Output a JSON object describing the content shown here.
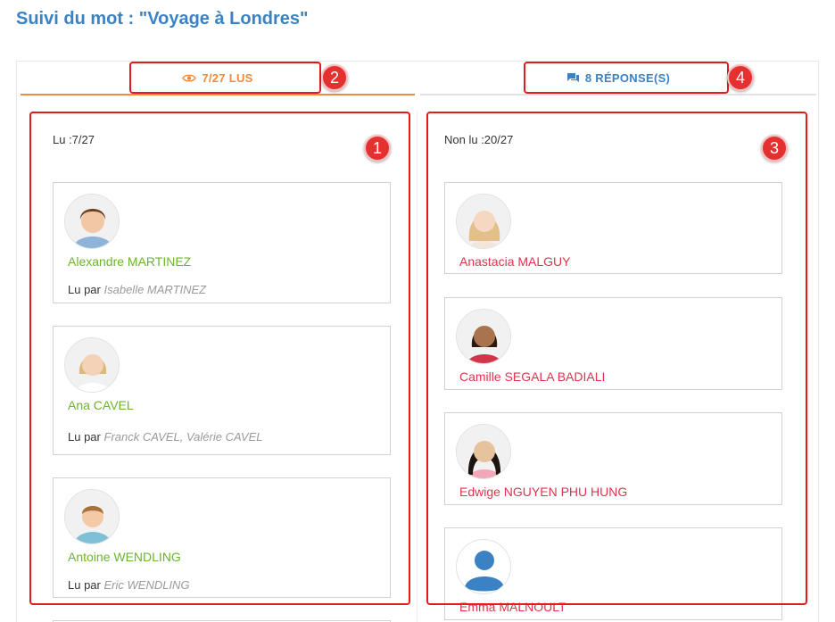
{
  "page": {
    "title": "Suivi du mot : \"Voyage à Londres\""
  },
  "tabs": {
    "read": {
      "label": "7/27 LUS",
      "icon": "eye-icon",
      "color": "#f08a3c"
    },
    "replies": {
      "label": "8 RÉPONSE(S)",
      "icon": "chat-bubbles-icon",
      "color": "#3a82c4"
    }
  },
  "read_column": {
    "label": "Lu :7/27",
    "read_by_prefix": "Lu par",
    "students": [
      {
        "name": "Alexandre MARTINEZ",
        "read_by": "Isabelle MARTINEZ"
      },
      {
        "name": "Ana CAVEL",
        "read_by": "Franck CAVEL, Valérie CAVEL"
      },
      {
        "name": "Antoine WENDLING",
        "read_by": "Eric WENDLING"
      }
    ]
  },
  "unread_column": {
    "label": "Non lu :20/27",
    "students": [
      {
        "name": "Anastacia MALGUY"
      },
      {
        "name": "Camille SEGALA BADIALI"
      },
      {
        "name": "Edwige NGUYEN PHU HUNG"
      },
      {
        "name": "Emma MALNOULT"
      }
    ]
  },
  "annotations": [
    "1",
    "2",
    "3",
    "4"
  ],
  "colors": {
    "title": "#3a82c4",
    "read_name": "#6bb52e",
    "unread_name": "#e0334c",
    "annotation": "#e51b1b"
  }
}
